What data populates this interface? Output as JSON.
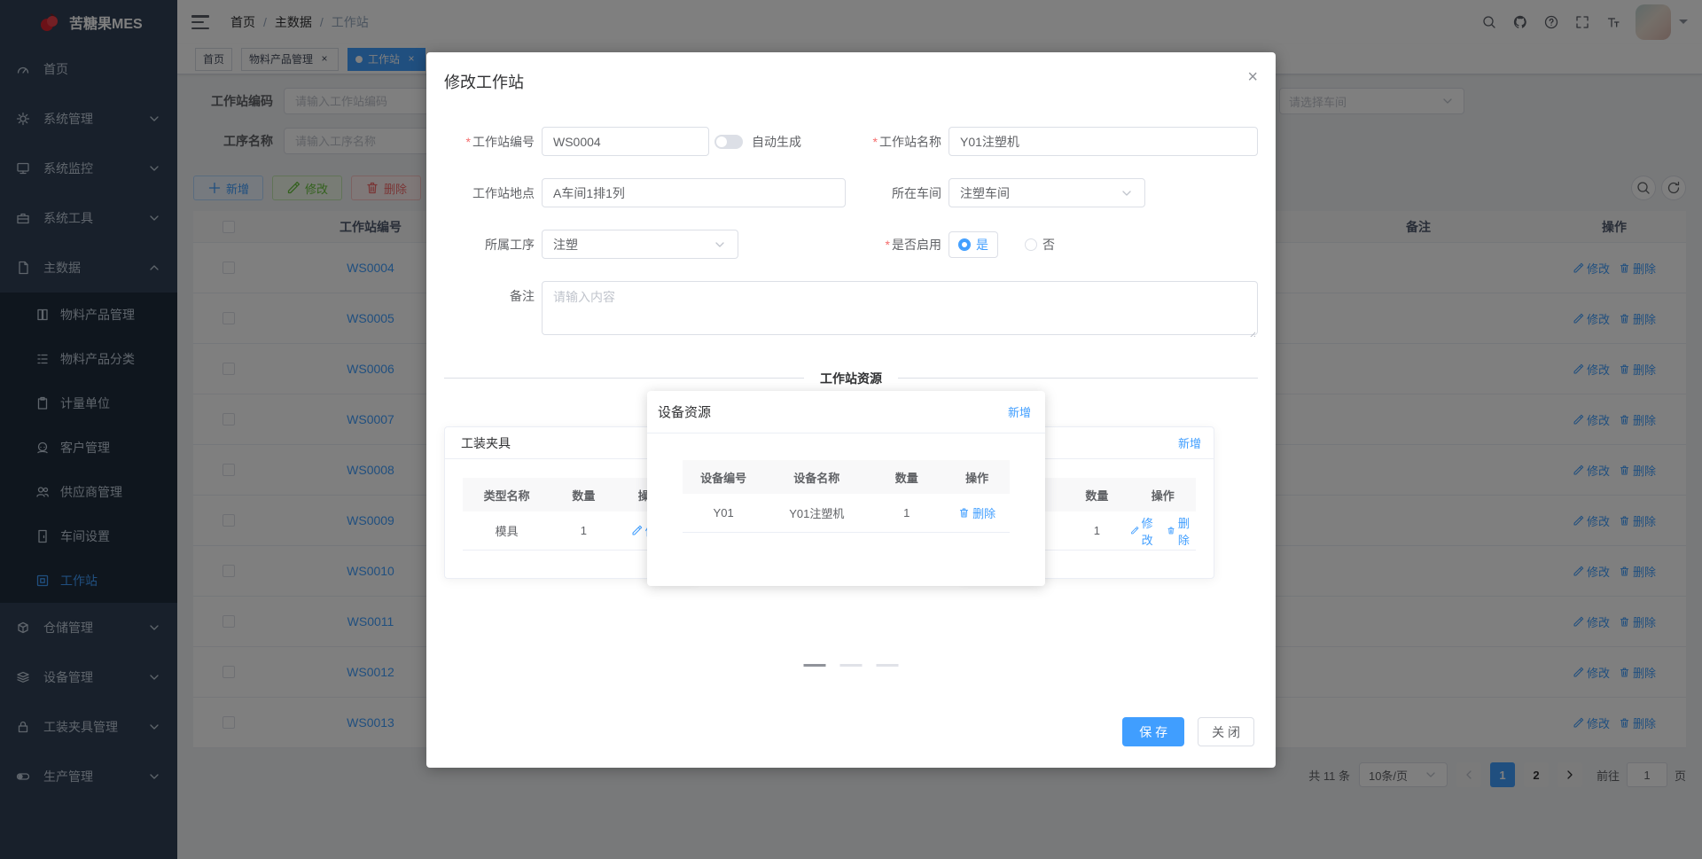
{
  "app": {
    "title": "苦糖果MES"
  },
  "navbar": {
    "breadcrumb": [
      "首页",
      "主数据",
      "工作站"
    ],
    "sep": "/"
  },
  "icons": {
    "close": "×",
    "plus": "+"
  },
  "tags": [
    {
      "label": "首页"
    },
    {
      "label": "物料产品管理"
    },
    {
      "label": "工作站"
    }
  ],
  "filters": {
    "code_label": "工作站编码",
    "code_placeholder": "请输入工作站编码",
    "process_label": "工序名称",
    "process_placeholder": "请输入工序名称",
    "workshop_placeholder": "请选择车间"
  },
  "toolbar": {
    "add": "新增",
    "edit": "修改",
    "delete": "删除"
  },
  "table": {
    "headers": {
      "code": "工作站编号",
      "remark": "备注",
      "action": "操作"
    },
    "row_edit": "修改",
    "row_delete": "删除",
    "rows": [
      {
        "code": "WS0004"
      },
      {
        "code": "WS0005"
      },
      {
        "code": "WS0006"
      },
      {
        "code": "WS0007"
      },
      {
        "code": "WS0008"
      },
      {
        "code": "WS0009"
      },
      {
        "code": "WS0010"
      },
      {
        "code": "WS0011"
      },
      {
        "code": "WS0012"
      },
      {
        "code": "WS0013"
      }
    ]
  },
  "pagination": {
    "total": "共 11 条",
    "page_size": "10条/页",
    "page1": "1",
    "page2": "2",
    "goto_label": "前往",
    "goto_value": "1",
    "unit": "页"
  },
  "sidebar": {
    "items": [
      {
        "label": "首页"
      },
      {
        "label": "系统管理"
      },
      {
        "label": "系统监控"
      },
      {
        "label": "系统工具"
      },
      {
        "label": "主数据"
      },
      {
        "label": "物料产品管理"
      },
      {
        "label": "物料产品分类"
      },
      {
        "label": "计量单位"
      },
      {
        "label": "客户管理"
      },
      {
        "label": "供应商管理"
      },
      {
        "label": "车间设置"
      },
      {
        "label": "工作站"
      },
      {
        "label": "仓储管理"
      },
      {
        "label": "设备管理"
      },
      {
        "label": "工装夹具管理"
      },
      {
        "label": "生产管理"
      }
    ]
  },
  "dialog": {
    "title": "修改工作站",
    "required_mark": "*",
    "fields": {
      "code_label": "工作站编号",
      "code_value": "WS0004",
      "auto_label": "自动生成",
      "name_label": "工作站名称",
      "name_value": "Y01注塑机",
      "location_label": "工作站地点",
      "location_value": "A车间1排1列",
      "workshop_label": "所在车间",
      "workshop_value": "注塑车间",
      "process_label": "所属工序",
      "process_value": "注塑",
      "enabled_label": "是否启用",
      "yes": "是",
      "no": "否",
      "remark_label": "备注",
      "remark_placeholder": "请输入内容"
    },
    "divider": "工作站资源",
    "fixture_card": {
      "title": "工装夹具",
      "headers": [
        "类型名称",
        "数量",
        "操作"
      ],
      "row": {
        "name": "模具",
        "qty": "1"
      },
      "edit": "修改"
    },
    "device_panel": {
      "title": "设备资源",
      "add": "新增",
      "headers": [
        "设备编号",
        "设备名称",
        "数量",
        "操作"
      ],
      "row": {
        "code": "Y01",
        "name": "Y01注塑机",
        "qty": "1"
      },
      "delete": "删除"
    },
    "right_card": {
      "add": "新增",
      "headers": [
        "数量",
        "操作"
      ],
      "row": {
        "qty": "1"
      },
      "edit": "修改",
      "delete": "删除"
    },
    "save": "保 存",
    "close": "关 闭"
  }
}
